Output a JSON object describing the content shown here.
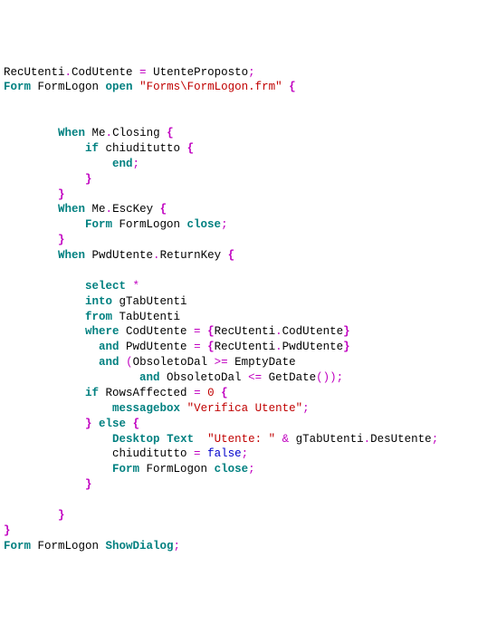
{
  "code": {
    "l01a": "RecUtenti",
    "l01b": ".",
    "l01c": "CodUtente ",
    "l01d": "=",
    "l01e": " UtenteProposto",
    "l01f": ";",
    "l02a": "Form",
    "l02b": " FormLogon ",
    "l02c": "open",
    "l02d": " ",
    "l02e": "\"Forms\\FormLogon.frm\"",
    "l02f": " ",
    "l02g": "{",
    "l05a": "When",
    "l05b": " Me",
    "l05c": ".",
    "l05d": "Closing ",
    "l05e": "{",
    "l06a": "if",
    "l06b": " chiuditutto ",
    "l06c": "{",
    "l07a": "end",
    "l07b": ";",
    "l08a": "}",
    "l09a": "}",
    "l10a": "When",
    "l10b": " Me",
    "l10c": ".",
    "l10d": "EscKey ",
    "l10e": "{",
    "l11a": "Form",
    "l11b": " FormLogon ",
    "l11c": "close",
    "l11d": ";",
    "l12a": "}",
    "l13a": "When",
    "l13b": " PwdUtente",
    "l13c": ".",
    "l13d": "ReturnKey ",
    "l13e": "{",
    "l15a": "select",
    "l15b": " ",
    "l15c": "*",
    "l16a": "into",
    "l16b": " gTabUtenti",
    "l17a": "from",
    "l17b": " TabUtenti",
    "l18a": "where",
    "l18b": " CodUtente ",
    "l18c": "=",
    "l18d": " ",
    "l18e": "{",
    "l18f": "RecUtenti",
    "l18g": ".",
    "l18h": "CodUtente",
    "l18i": "}",
    "l19a": "and",
    "l19b": " PwdUtente ",
    "l19c": "=",
    "l19d": " ",
    "l19e": "{",
    "l19f": "RecUtenti",
    "l19g": ".",
    "l19h": "PwdUtente",
    "l19i": "}",
    "l20a": "and",
    "l20b": " ",
    "l20c": "(",
    "l20d": "ObsoletoDal ",
    "l20e": ">=",
    "l20f": " EmptyDate",
    "l21a": "and",
    "l21b": " ObsoletoDal ",
    "l21c": "<=",
    "l21d": " GetDate",
    "l21e": "(",
    "l21f": ")",
    "l21g": ")",
    "l21h": ";",
    "l22a": "if",
    "l22b": " RowsAffected ",
    "l22c": "=",
    "l22d": " ",
    "l22e": "0",
    "l22f": " ",
    "l22g": "{",
    "l23a": "messagebox",
    "l23b": " ",
    "l23c": "\"Verifica Utente\"",
    "l23d": ";",
    "l24a": "}",
    "l24b": " ",
    "l24c": "else",
    "l24d": " ",
    "l24e": "{",
    "l25a": "Desktop",
    "l25b": " ",
    "l25c": "Text",
    "l25d": "  ",
    "l25e": "\"Utente: \"",
    "l25f": " ",
    "l25g": "&",
    "l25h": " gTabUtenti",
    "l25i": ".",
    "l25j": "DesUtente",
    "l25k": ";",
    "l26a": "chiuditutto ",
    "l26b": "=",
    "l26c": " ",
    "l26d": "false",
    "l26e": ";",
    "l27a": "Form",
    "l27b": " FormLogon ",
    "l27c": "close",
    "l27d": ";",
    "l28a": "}",
    "l30a": "}",
    "l31a": "}",
    "l32a": "Form",
    "l32b": " FormLogon ",
    "l32c": "ShowDialog",
    "l32d": ";"
  }
}
